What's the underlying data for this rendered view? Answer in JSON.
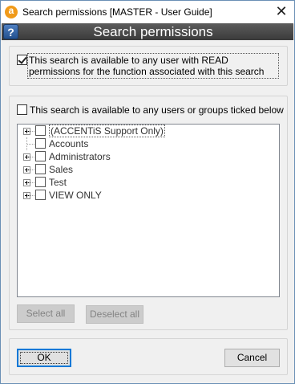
{
  "window": {
    "title": "Search permissions [MASTER - User Guide]",
    "close_glyph": "✕"
  },
  "banner": {
    "help_glyph": "?",
    "title": "Search permissions"
  },
  "option_read_permissions": {
    "label": "This search is available to any user with READ permissions for the function associated with this search",
    "checked": true
  },
  "option_selected_users": {
    "label": "This search is available to any users or groups ticked below",
    "checked": false
  },
  "tree": {
    "items": [
      {
        "label": "(ACCENTiS Support Only)",
        "expandable": true,
        "checked": false
      },
      {
        "label": "Accounts",
        "expandable": false,
        "checked": false
      },
      {
        "label": "Administrators",
        "expandable": true,
        "checked": false
      },
      {
        "label": "Sales",
        "expandable": true,
        "checked": false
      },
      {
        "label": "Test",
        "expandable": true,
        "checked": false
      },
      {
        "label": "VIEW ONLY",
        "expandable": true,
        "checked": false
      }
    ]
  },
  "buttons": {
    "select_all": "Select all",
    "deselect_all": "Deselect all",
    "ok": "OK",
    "cancel": "Cancel"
  },
  "colors": {
    "banner_bg": "#4a4a4a",
    "app_icon": "#f09a1a",
    "help_icon": "#2d62a8",
    "default_button_border": "#0078d7"
  }
}
